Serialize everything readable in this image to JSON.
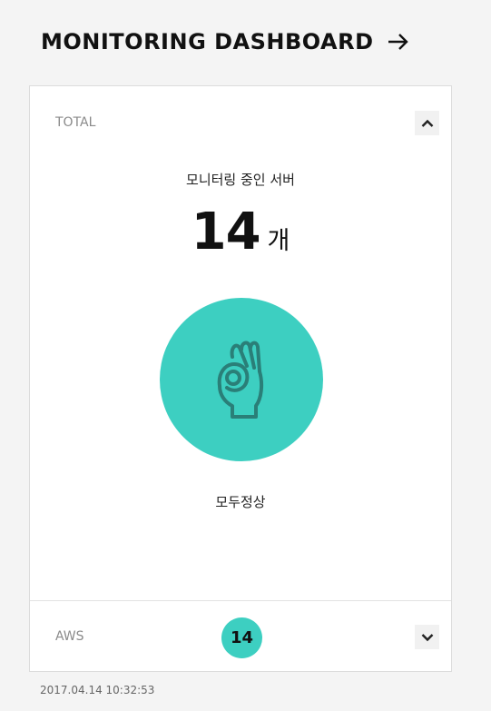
{
  "header": {
    "title": "MONITORING DASHBOARD",
    "arrow_icon": "arrow-right-icon"
  },
  "total": {
    "label": "TOTAL",
    "toggle_icon": "chevron-up-icon",
    "subtitle": "모니터링 중인 서버",
    "count": "14",
    "unit": "개",
    "status_icon": "ok-hand-icon",
    "status_color": "#3dcfc1",
    "status_text": "모두정상"
  },
  "aws": {
    "label": "AWS",
    "count": "14",
    "toggle_icon": "chevron-down-icon"
  },
  "footer": {
    "timestamp": "2017.04.14 10:32:53"
  }
}
